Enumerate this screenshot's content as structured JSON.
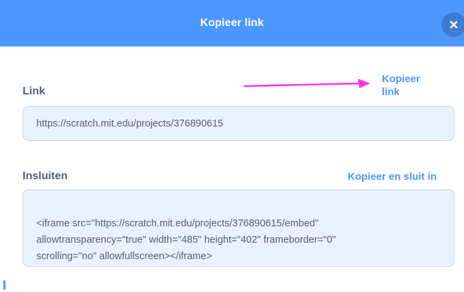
{
  "dialog": {
    "title": "Kopieer link",
    "close_icon": "close-icon"
  },
  "link_section": {
    "label": "Link",
    "copy_label_line1": "Kopieer",
    "copy_label_line2": "link",
    "value": "https://scratch.mit.edu/projects/376890615"
  },
  "embed_section": {
    "label": "Insluiten",
    "copy_label": "Kopieer en sluit in",
    "value": "<iframe src=\"https://scratch.mit.edu/projects/376890615/embed\" allowtransparency=\"true\" width=\"485\" height=\"402\" frameborder=\"0\" scrolling=\"no\" allowfullscreen></iframe>"
  },
  "annotation": {
    "arrow_icon": "arrow-right-icon",
    "arrow_color": "#ff33e6"
  },
  "colors": {
    "header": "#4c97ff",
    "accent": "#4c97ff",
    "label_text": "#575e75",
    "field_bg": "#e9f1fc"
  }
}
